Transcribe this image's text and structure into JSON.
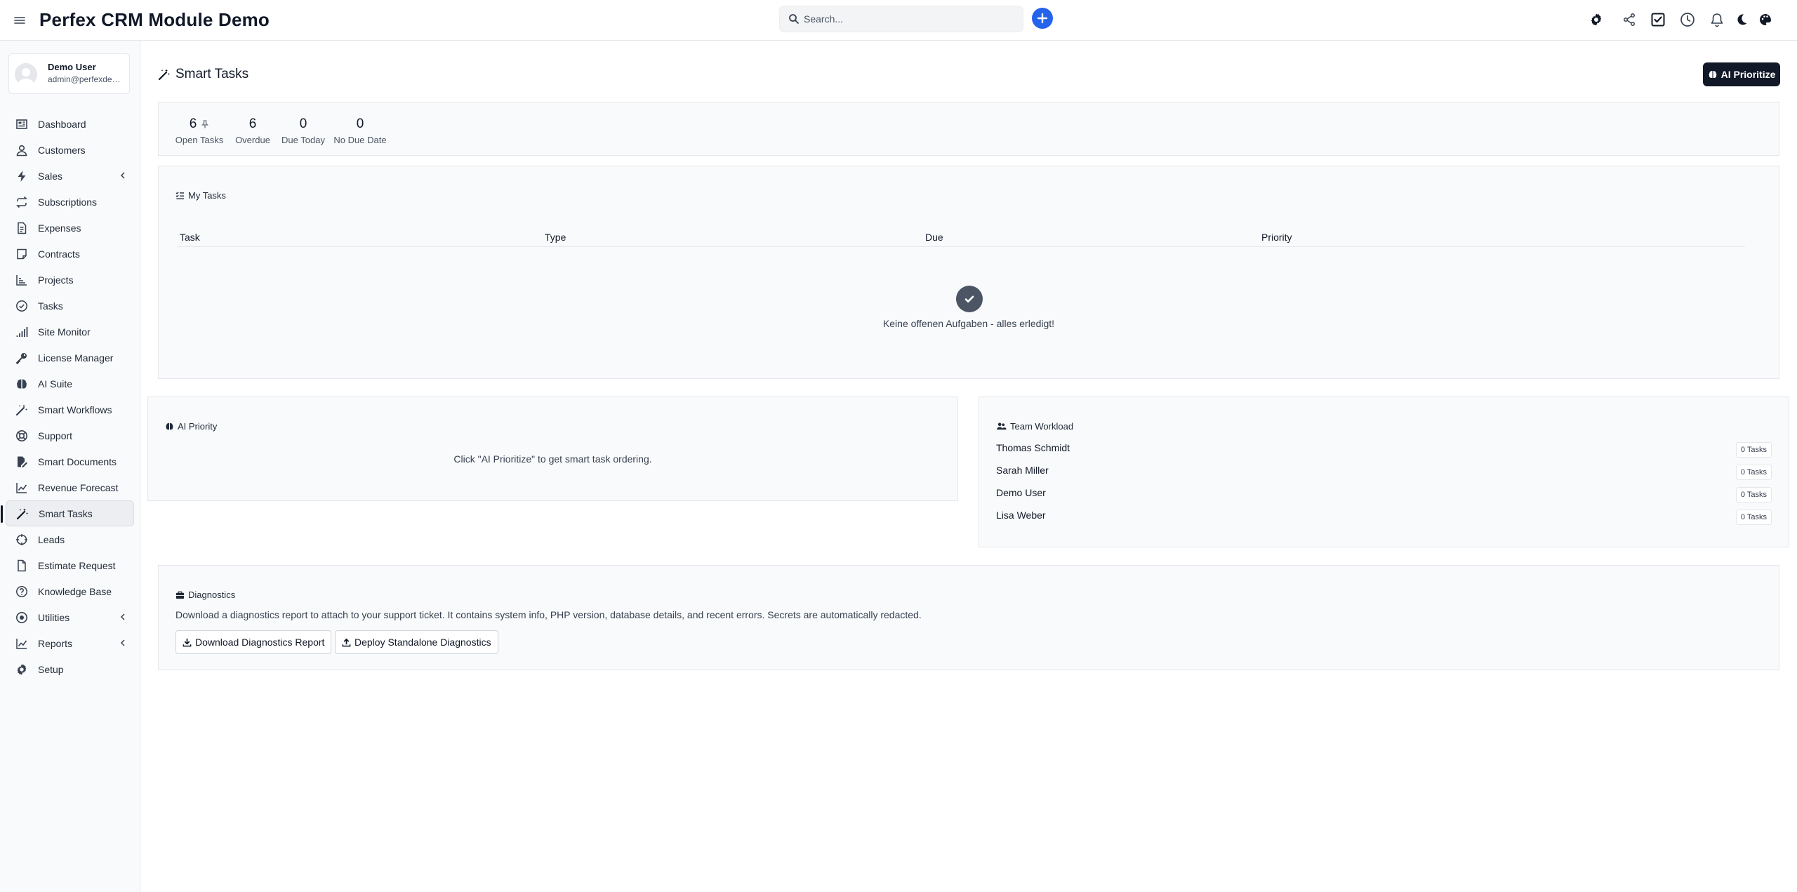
{
  "app": {
    "title": "Perfex CRM Module Demo"
  },
  "search": {
    "placeholder": "Search..."
  },
  "header_icons": [
    "gear-icon",
    "share-icon",
    "checkbox-icon",
    "clock-icon",
    "bell-icon",
    "moon-icon",
    "palette-icon"
  ],
  "user": {
    "name": "Demo User",
    "email": "admin@perfexdemo.com"
  },
  "sidebar": {
    "items": [
      {
        "label": "Dashboard",
        "icon": "dashboard-icon"
      },
      {
        "label": "Customers",
        "icon": "user-icon"
      },
      {
        "label": "Sales",
        "icon": "bolt-icon",
        "has_submenu": true
      },
      {
        "label": "Subscriptions",
        "icon": "repeat-icon"
      },
      {
        "label": "Expenses",
        "icon": "file-text-icon"
      },
      {
        "label": "Contracts",
        "icon": "contract-icon"
      },
      {
        "label": "Projects",
        "icon": "chart-icon"
      },
      {
        "label": "Tasks",
        "icon": "check-circle-icon"
      },
      {
        "label": "Site Monitor",
        "icon": "signal-icon"
      },
      {
        "label": "License Manager",
        "icon": "key-icon"
      },
      {
        "label": "AI Suite",
        "icon": "brain-icon"
      },
      {
        "label": "Smart Workflows",
        "icon": "magic-wand-icon"
      },
      {
        "label": "Support",
        "icon": "lifebuoy-icon"
      },
      {
        "label": "Smart Documents",
        "icon": "document-edit-icon"
      },
      {
        "label": "Revenue Forecast",
        "icon": "line-chart-icon"
      },
      {
        "label": "Smart Tasks",
        "icon": "magic-wand-icon",
        "active": true
      },
      {
        "label": "Leads",
        "icon": "crosshair-icon"
      },
      {
        "label": "Estimate Request",
        "icon": "file-icon"
      },
      {
        "label": "Knowledge Base",
        "icon": "question-circle-icon"
      },
      {
        "label": "Utilities",
        "icon": "dot-circle-icon",
        "has_submenu": true
      },
      {
        "label": "Reports",
        "icon": "line-chart-icon",
        "has_submenu": true
      },
      {
        "label": "Setup",
        "icon": "gear-icon"
      }
    ]
  },
  "page": {
    "title": "Smart Tasks",
    "ai_button": "AI Prioritize"
  },
  "stats": [
    {
      "value": "6",
      "label": "Open Tasks",
      "pinned": true
    },
    {
      "value": "6",
      "label": "Overdue"
    },
    {
      "value": "0",
      "label": "Due Today"
    },
    {
      "value": "0",
      "label": "No Due Date"
    }
  ],
  "my_tasks": {
    "title": "My Tasks",
    "columns": [
      "Task",
      "Type",
      "Due",
      "Priority"
    ],
    "empty_text": "Keine offenen Aufgaben - alles erledigt!"
  },
  "ai_priority": {
    "title": "AI Priority",
    "hint": "Click \"AI Prioritize\" to get smart task ordering."
  },
  "team_workload": {
    "title": "Team Workload",
    "members": [
      {
        "name": "Thomas Schmidt",
        "tasks": "0 Tasks"
      },
      {
        "name": "Sarah Miller",
        "tasks": "0 Tasks"
      },
      {
        "name": "Demo User",
        "tasks": "0 Tasks"
      },
      {
        "name": "Lisa Weber",
        "tasks": "0 Tasks"
      }
    ]
  },
  "diagnostics": {
    "title": "Diagnostics",
    "description": "Download a diagnostics report to attach to your support ticket. It contains system info, PHP version, database details, and recent errors. Secrets are automatically redacted.",
    "download_button": "Download Diagnostics Report",
    "deploy_button": "Deploy Standalone Diagnostics"
  },
  "colors": {
    "accent_blue": "#2563eb",
    "dark_button": "#111827",
    "panel_bg": "#f9fafb"
  }
}
